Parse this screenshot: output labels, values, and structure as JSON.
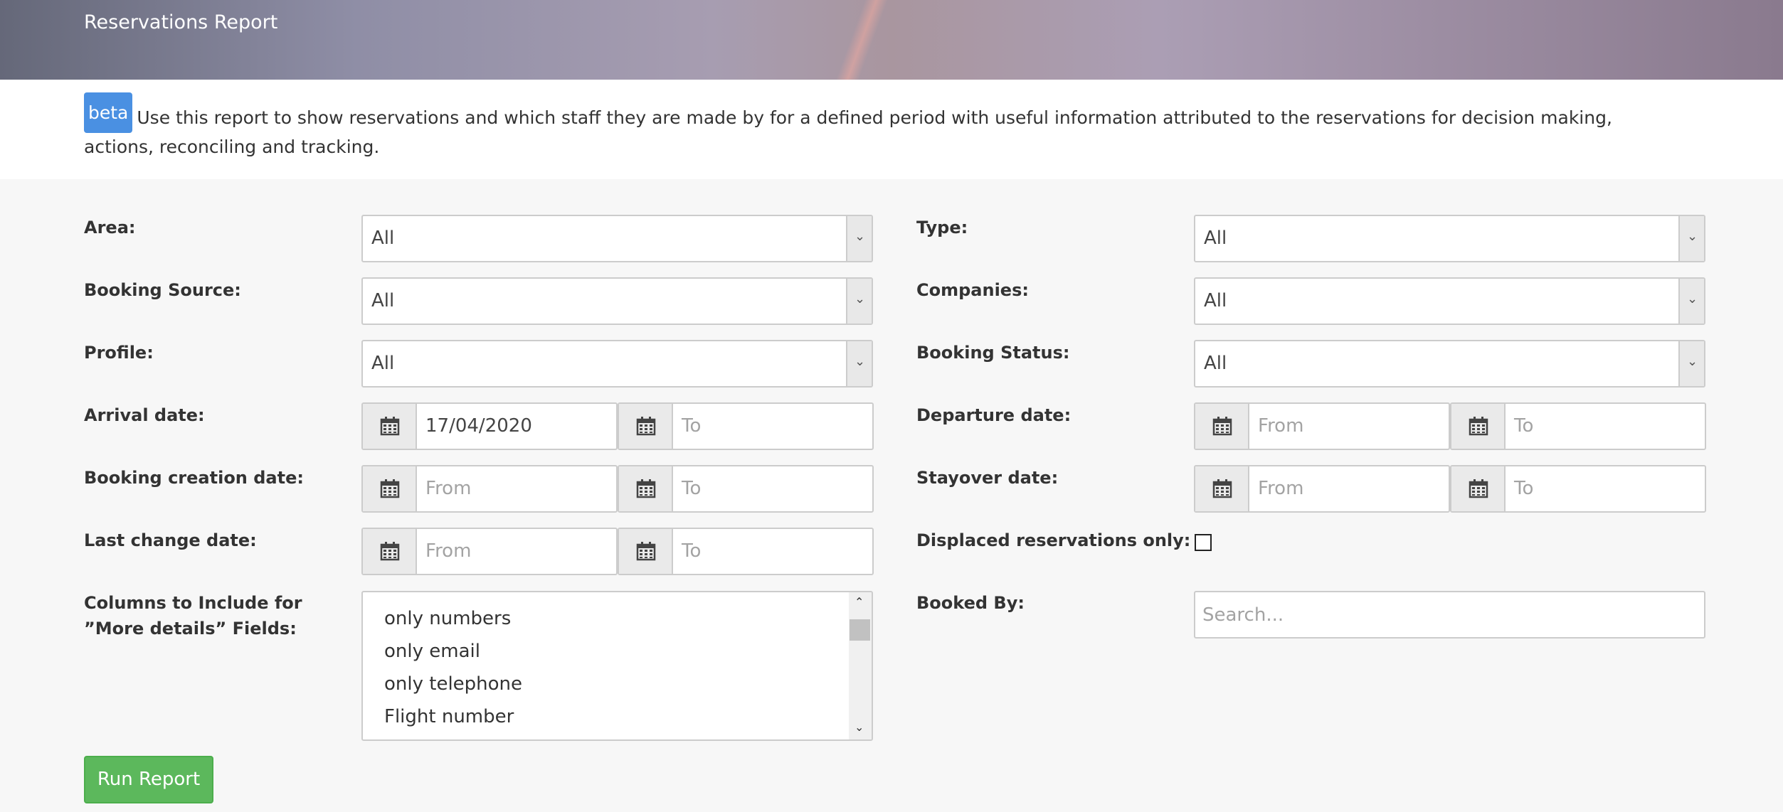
{
  "header": {
    "title": "Reservations Report"
  },
  "info": {
    "badge": "beta",
    "text": "Use this report to show reservations and which staff they are made by for a defined period with useful information attributed to the reservations for decision making, actions, reconciling and tracking."
  },
  "form": {
    "area": {
      "label": "Area:",
      "value": "All"
    },
    "type": {
      "label": "Type:",
      "value": "All"
    },
    "booking_source": {
      "label": "Booking Source:",
      "value": "All"
    },
    "companies": {
      "label": "Companies:",
      "value": "All"
    },
    "profile": {
      "label": "Profile:",
      "value": "All"
    },
    "booking_status": {
      "label": "Booking Status:",
      "value": "All"
    },
    "arrival_date": {
      "label": "Arrival date:",
      "from": "17/04/2020",
      "to_placeholder": "To"
    },
    "departure_date": {
      "label": "Departure date:",
      "from_placeholder": "From",
      "to_placeholder": "To"
    },
    "booking_creation_date": {
      "label": "Booking creation date:",
      "from_placeholder": "From",
      "to_placeholder": "To"
    },
    "stayover_date": {
      "label": "Stayover date:",
      "from_placeholder": "From",
      "to_placeholder": "To"
    },
    "last_change_date": {
      "label": "Last change date:",
      "from_placeholder": "From",
      "to_placeholder": "To"
    },
    "displaced_only": {
      "label": "Displaced reservations only:",
      "checked": false
    },
    "columns": {
      "label_line1": "Columns to Include for",
      "label_line2": "”More details” Fields:",
      "options": [
        "only numbers",
        "only email",
        "only telephone",
        "Flight number"
      ]
    },
    "booked_by": {
      "label": "Booked By:",
      "placeholder": "Search..."
    },
    "run_button": "Run Report"
  },
  "icons": {
    "calendar": "calendar-icon",
    "dropdown": "chevron-down-icon"
  }
}
